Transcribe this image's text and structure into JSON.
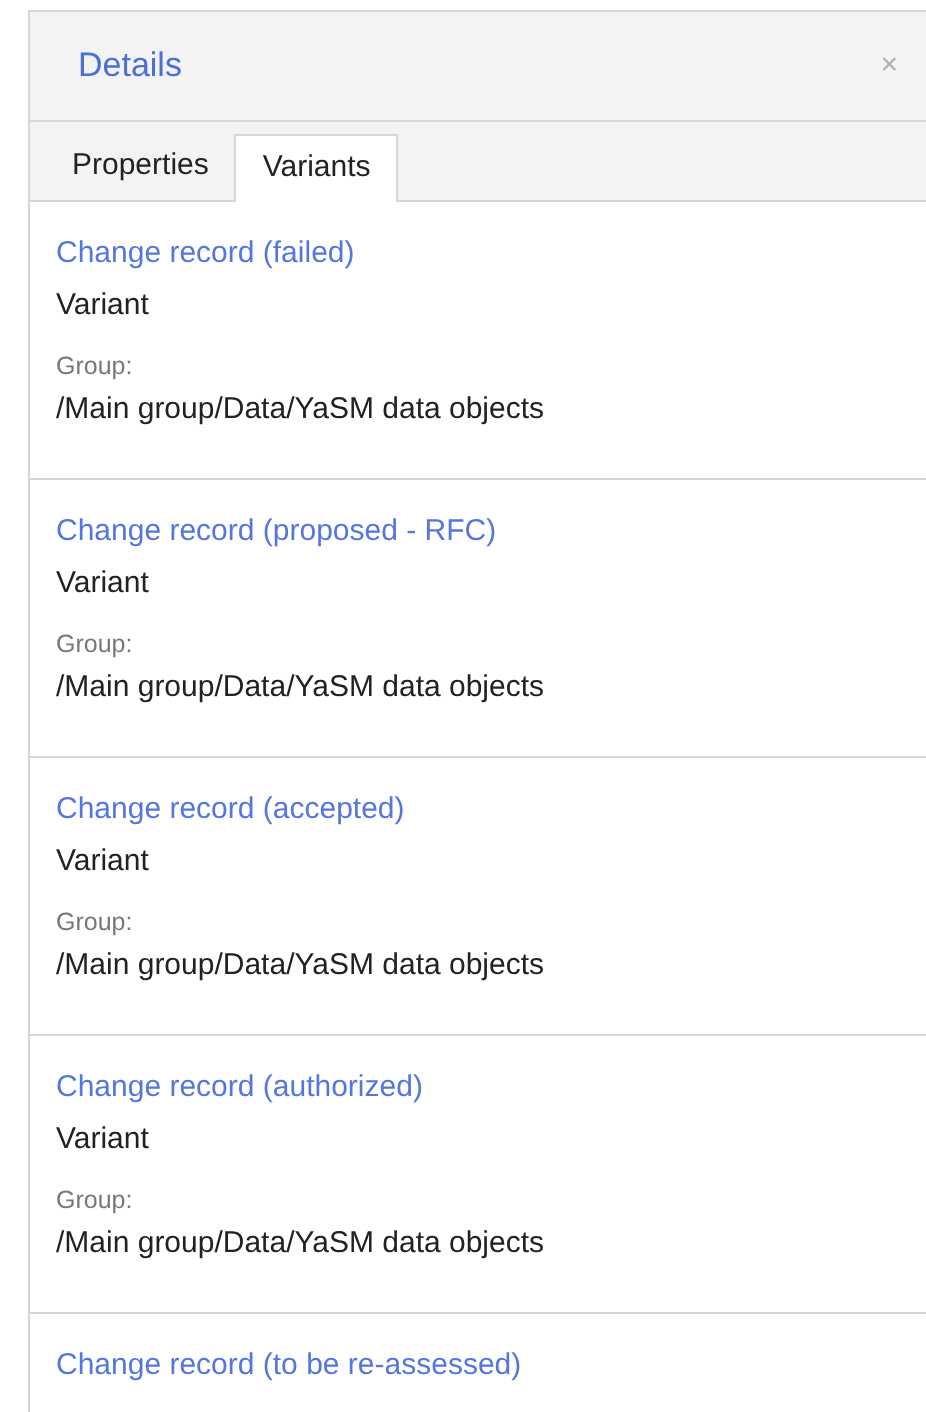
{
  "panel": {
    "title": "Details",
    "close": "×"
  },
  "tabs": [
    {
      "label": "Properties",
      "selected": false
    },
    {
      "label": "Variants",
      "selected": true
    }
  ],
  "variants": [
    {
      "name": "Change record (failed)",
      "type": "Variant",
      "group_label": "Group:",
      "group": "/Main group/Data/YaSM data objects"
    },
    {
      "name": "Change record (proposed - RFC)",
      "type": "Variant",
      "group_label": "Group:",
      "group": "/Main group/Data/YaSM data objects"
    },
    {
      "name": "Change record (accepted)",
      "type": "Variant",
      "group_label": "Group:",
      "group": "/Main group/Data/YaSM data objects"
    },
    {
      "name": "Change record (authorized)",
      "type": "Variant",
      "group_label": "Group:",
      "group": "/Main group/Data/YaSM data objects"
    },
    {
      "name": "Change record (to be re-assessed)"
    }
  ]
}
